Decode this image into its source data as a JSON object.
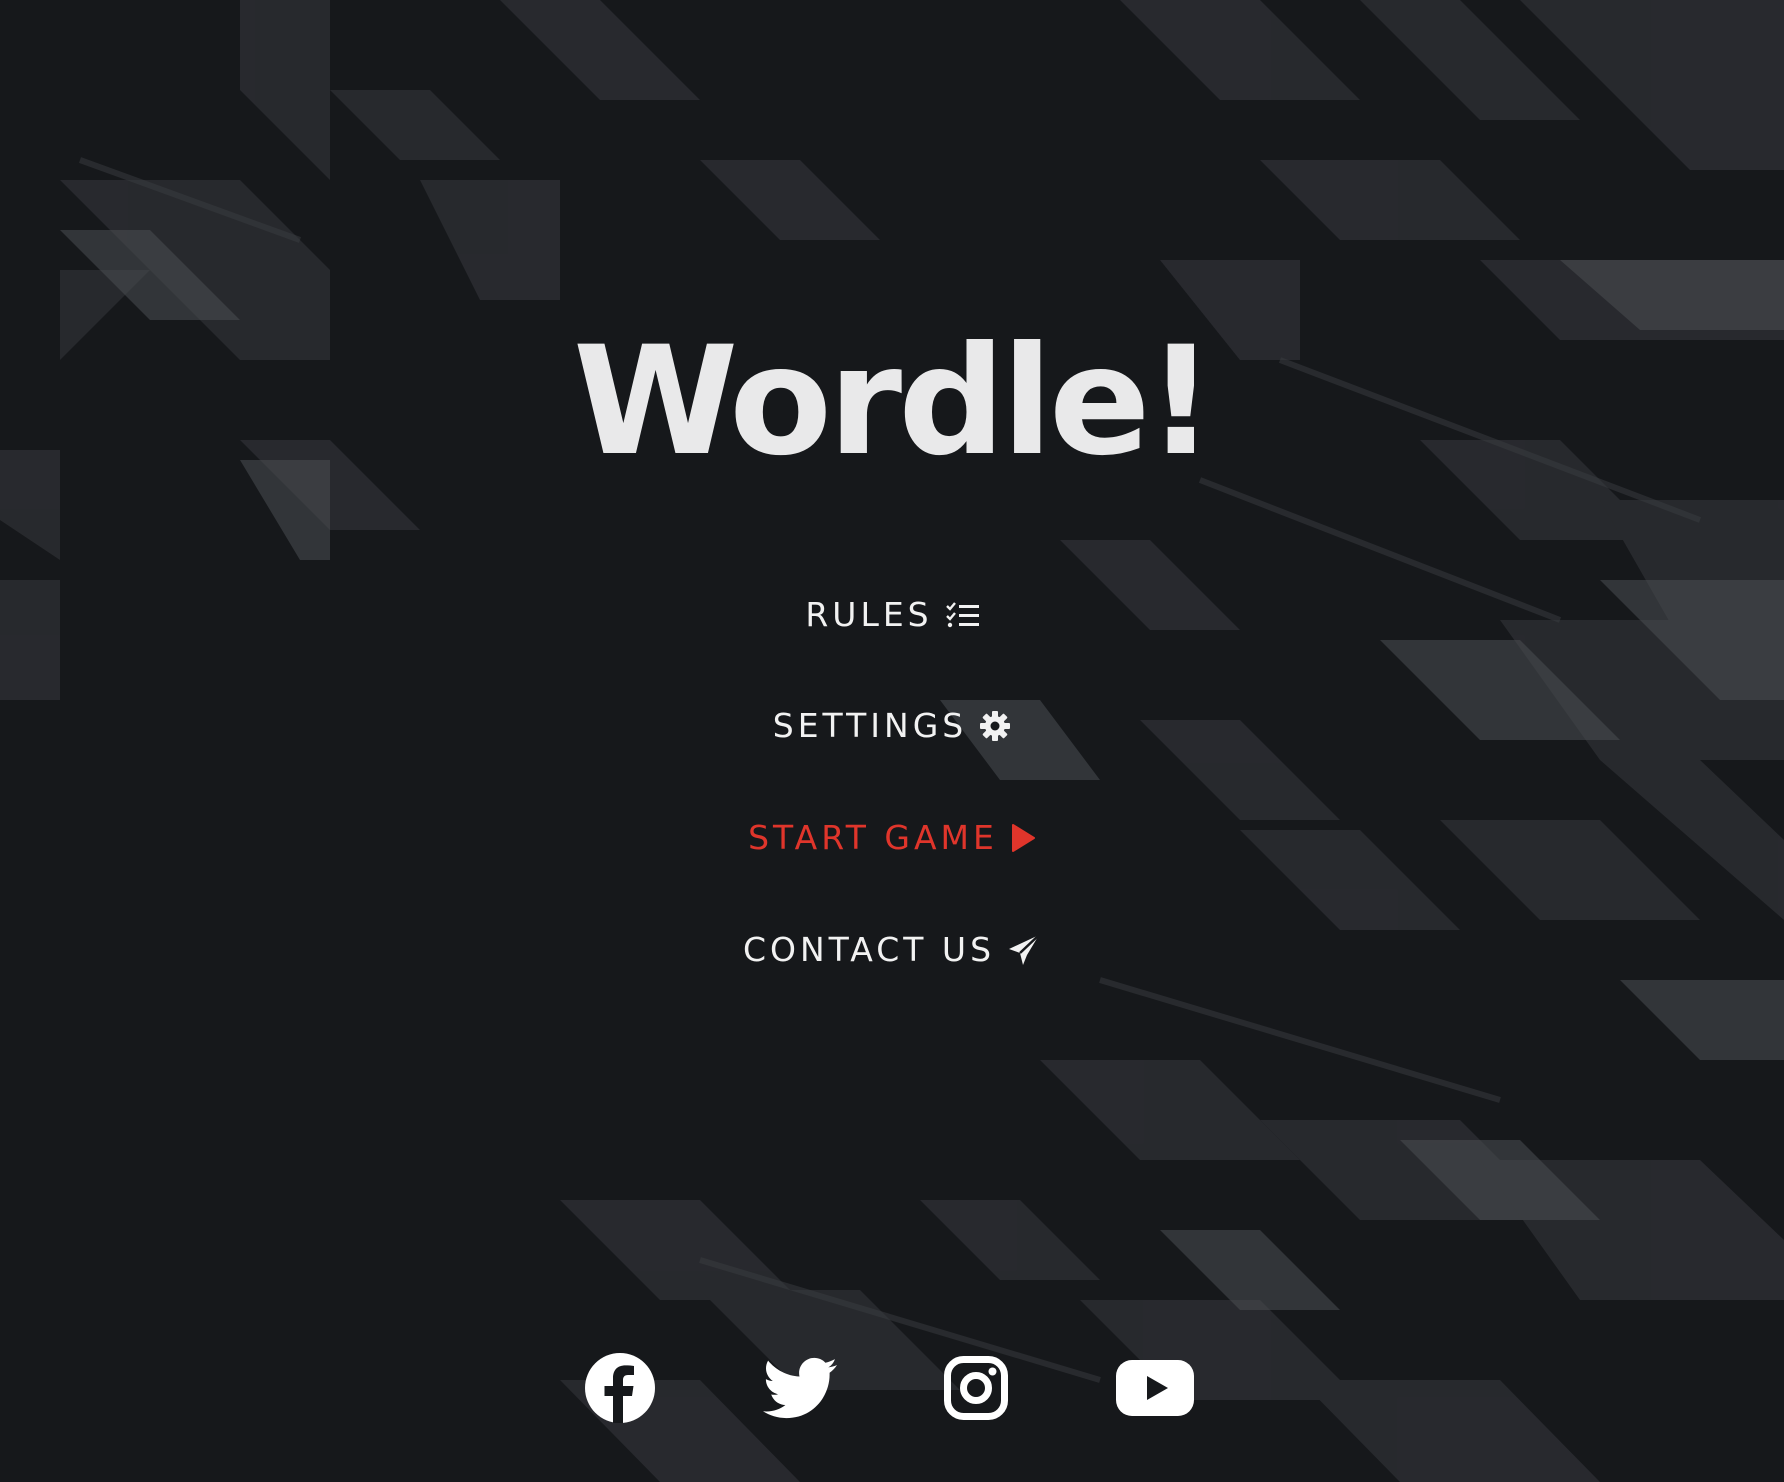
{
  "app": {
    "title": "Wordle!"
  },
  "menu": {
    "rules": {
      "label": "RULES",
      "icon": "list-check-icon"
    },
    "settings": {
      "label": "SETTINGS",
      "icon": "gear-icon"
    },
    "start": {
      "label": "START GAME",
      "icon": "play-icon",
      "color": "#e0352b"
    },
    "contact": {
      "label": "CONTACT US",
      "icon": "paper-plane-icon"
    }
  },
  "social": [
    "facebook-icon",
    "twitter-icon",
    "instagram-icon",
    "youtube-icon"
  ],
  "colors": {
    "background": "#16181b",
    "text": "#f2f2f2",
    "accent": "#e0352b"
  }
}
